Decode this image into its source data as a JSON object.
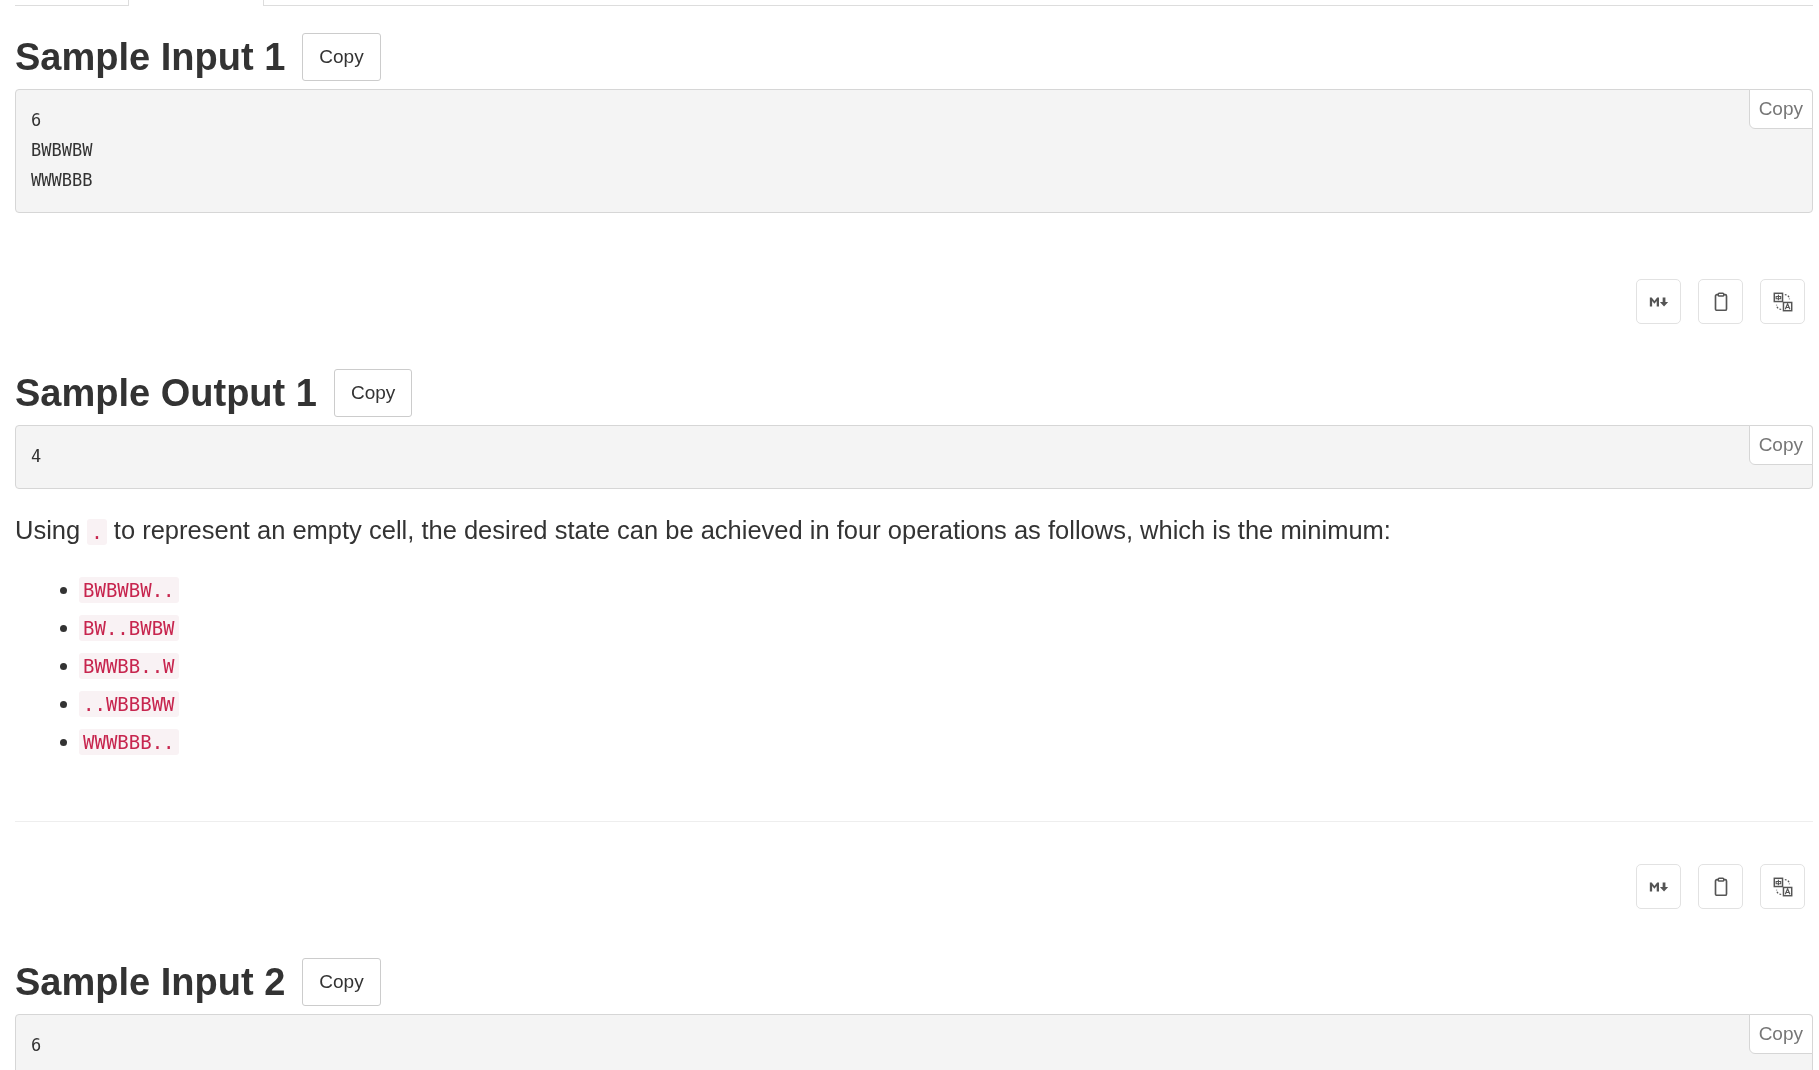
{
  "sections": [
    {
      "kind": "sample",
      "heading": "Sample Input 1",
      "copy_label": "Copy",
      "corner_copy_label": "Copy",
      "lines": [
        "6",
        "BWBWBW",
        "WWWBBB"
      ]
    },
    {
      "kind": "toolbar"
    },
    {
      "kind": "sample",
      "heading": "Sample Output 1",
      "copy_label": "Copy",
      "corner_copy_label": "Copy",
      "lines": [
        "4"
      ]
    },
    {
      "kind": "note",
      "parts": [
        {
          "kind": "text",
          "text": "Using "
        },
        {
          "kind": "code",
          "text": "."
        },
        {
          "kind": "text",
          "text": " to represent an empty cell, the desired state can be achieved in four operations as follows, which is the minimum:"
        }
      ],
      "items": [
        "BWBWBW..",
        "BW..BWBW",
        "BWWBB..W",
        "..WBBBWW",
        "WWWBBB.."
      ]
    },
    {
      "kind": "divider"
    },
    {
      "kind": "toolbar"
    },
    {
      "kind": "sample",
      "heading": "Sample Input 2",
      "copy_label": "Copy",
      "corner_copy_label": "Copy",
      "lines": [
        "6"
      ]
    }
  ]
}
